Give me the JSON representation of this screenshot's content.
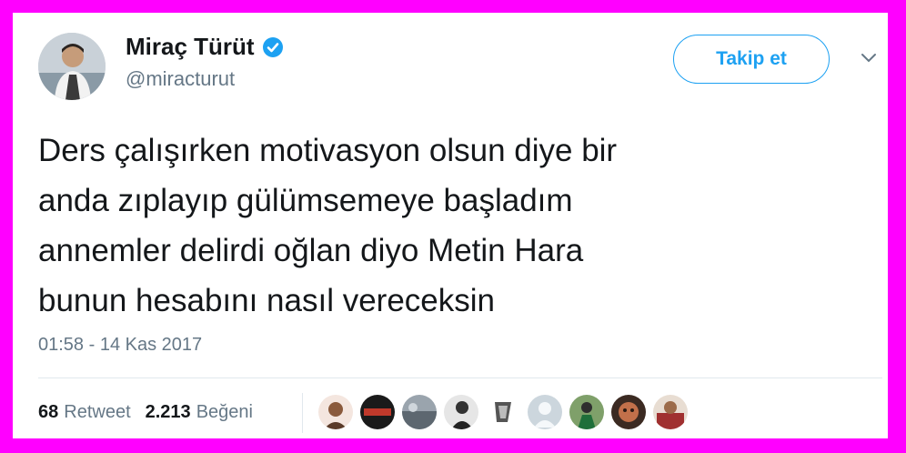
{
  "user": {
    "name": "Miraç Türüt",
    "handle": "@miracturut",
    "verified": true,
    "follow_label": "Takip et"
  },
  "tweet": {
    "lines": [
      "Ders çalışırken motivasyon olsun diye bir",
      "anda zıplayıp gülümsemeye başladım",
      "annemler delirdi oğlan diyo Metin Hara",
      "bunun hesabını nasıl vereceksin"
    ],
    "timestamp": "01:58 - 14 Kas 2017"
  },
  "stats": {
    "retweet_count": "68",
    "retweet_label": "Retweet",
    "like_count": "2.213",
    "like_label": "Beğeni"
  },
  "colors": {
    "frame": "#ff00ff",
    "accent": "#1da1f2",
    "text": "#14171a",
    "muted": "#657786"
  },
  "likers": [
    "liker-avatar-1",
    "liker-avatar-2",
    "liker-avatar-3",
    "liker-avatar-4",
    "liker-avatar-5",
    "liker-avatar-6",
    "liker-avatar-7",
    "liker-avatar-8",
    "liker-avatar-9",
    "liker-avatar-10"
  ]
}
